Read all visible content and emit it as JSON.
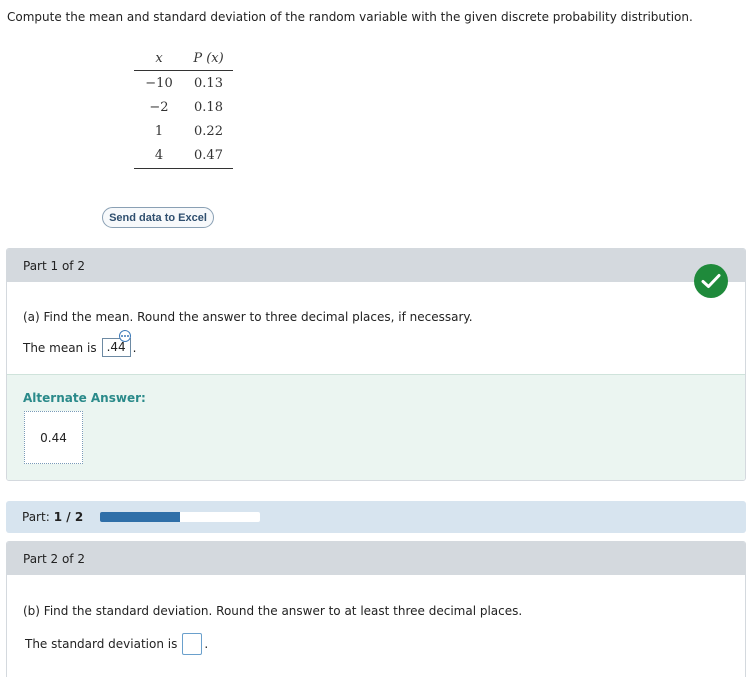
{
  "prompt": "Compute the mean and standard deviation of the random variable with the given discrete probability distribution.",
  "table": {
    "header": {
      "x": "x",
      "p": "P (x)"
    },
    "rows": [
      {
        "x": "−10",
        "p": "0.13"
      },
      {
        "x": "−2",
        "p": "0.18"
      },
      {
        "x": "1",
        "p": "0.22"
      },
      {
        "x": "4",
        "p": "0.47"
      }
    ]
  },
  "excel_button": "Send data to Excel",
  "part1": {
    "header": "Part 1 of 2",
    "status_icon": "check-icon",
    "question": "(a) Find the mean. Round the answer to three decimal places, if necessary.",
    "answer_prefix": "The mean is",
    "answer_value": ".44",
    "answer_suffix": ".",
    "alternate_title": "Alternate Answer:",
    "alternate_value": "0.44"
  },
  "progress": {
    "label": "Part:",
    "value": "1 / 2",
    "fraction": 0.5
  },
  "part2": {
    "header": "Part 2 of 2",
    "question": "(b) Find the standard deviation. Round the answer to at least three decimal places.",
    "answer_prefix": "The standard deviation is",
    "answer_suffix": "."
  },
  "colors": {
    "success": "#1f8a3b",
    "accent": "#2f6fa8",
    "alt_title": "#2a8a8a"
  }
}
